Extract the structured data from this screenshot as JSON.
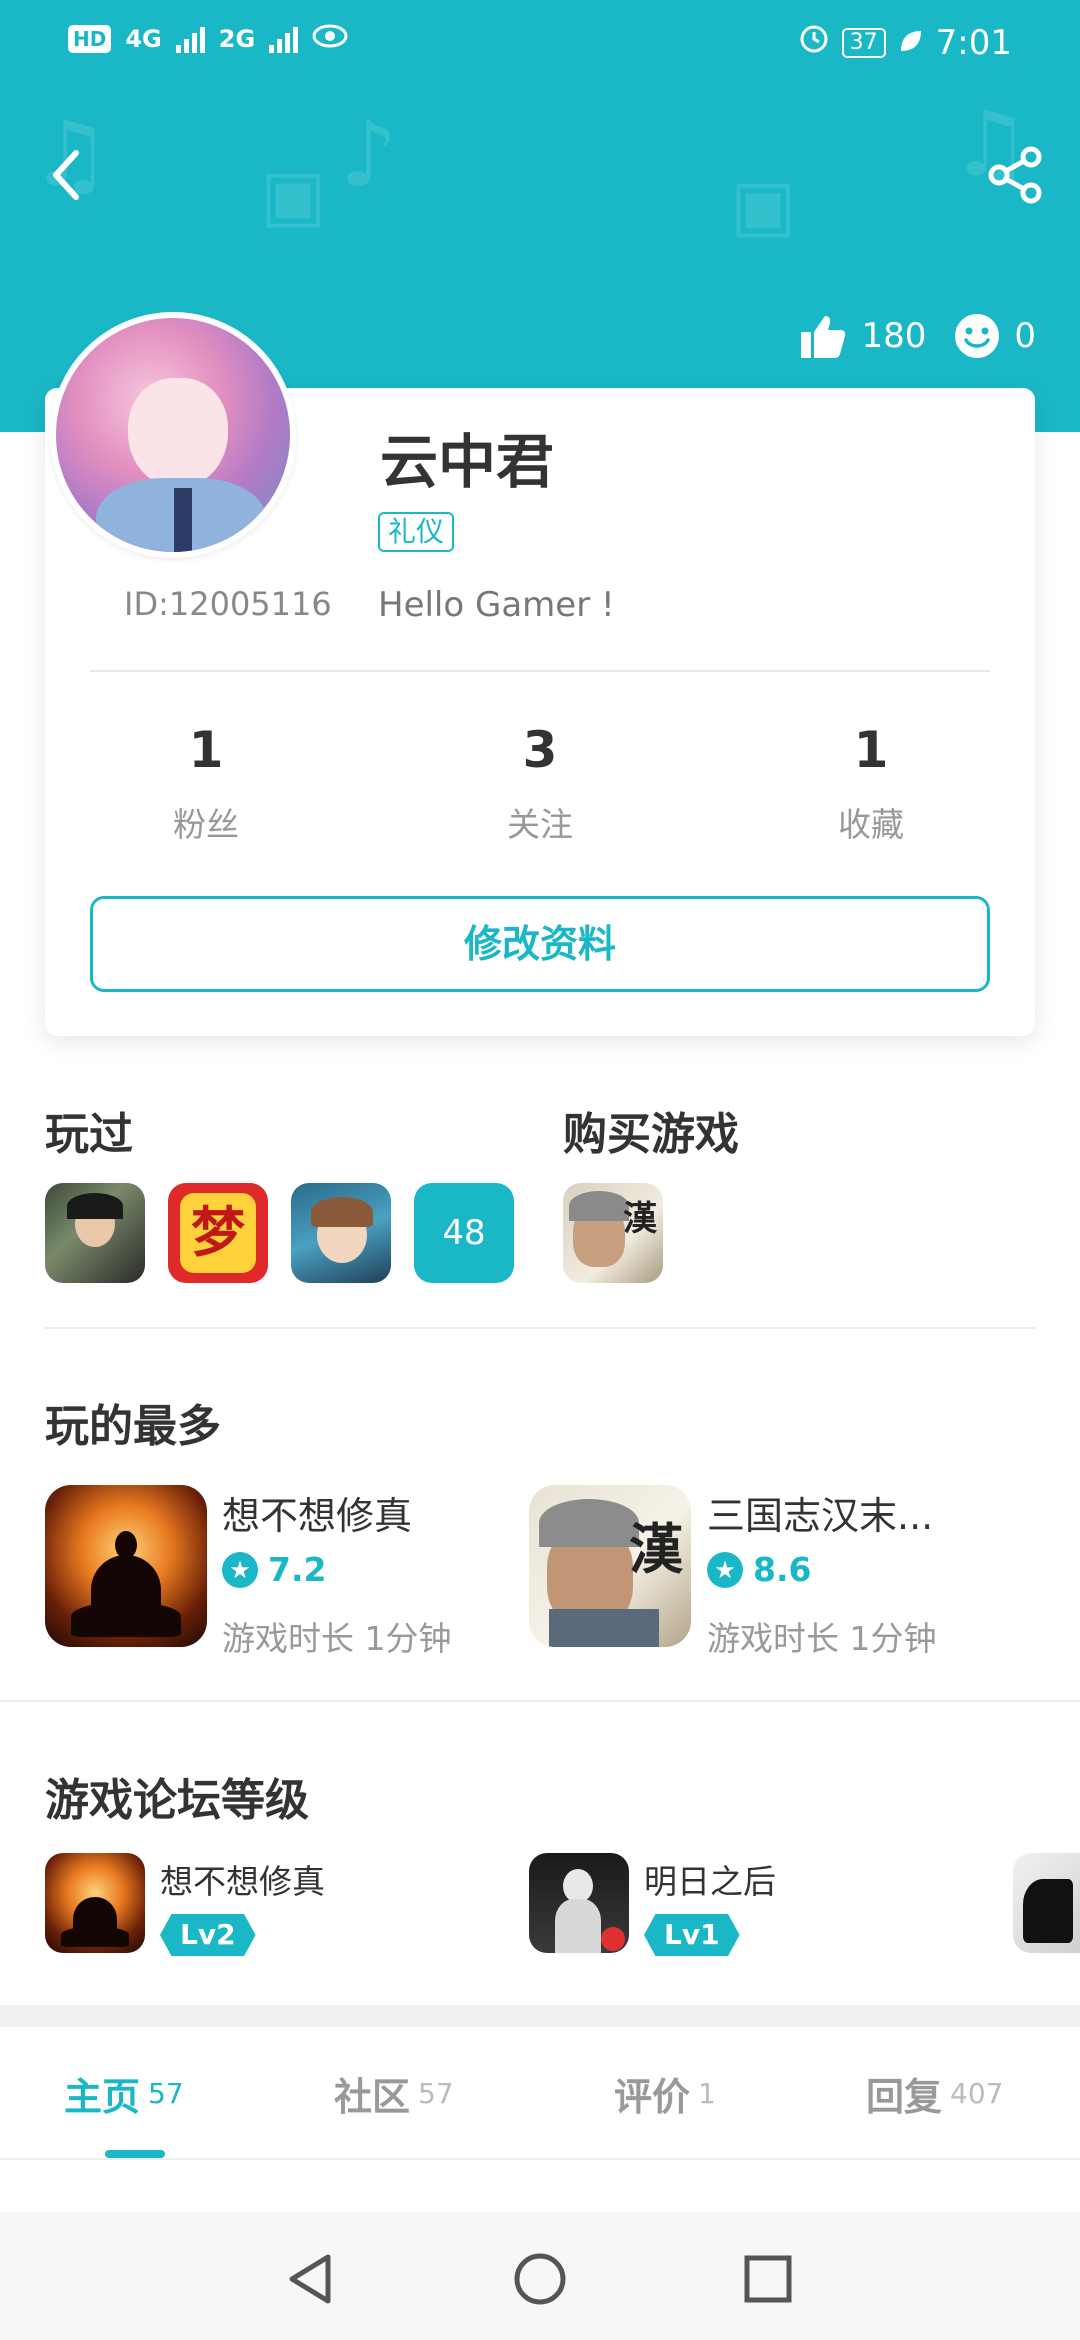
{
  "status_bar": {
    "hd": "HD",
    "net1": "4G",
    "net2": "2G",
    "battery": "37",
    "time": "7:01"
  },
  "header": {
    "likes": "180",
    "smiles": "0"
  },
  "profile": {
    "username": "云中君",
    "tag": "礼仪",
    "id": "ID:12005116",
    "bio": "Hello Gamer !",
    "stats": [
      {
        "num": "1",
        "label": "粉丝"
      },
      {
        "num": "3",
        "label": "关注"
      },
      {
        "num": "1",
        "label": "收藏"
      }
    ],
    "edit_label": "修改资料"
  },
  "played": {
    "title": "玩过",
    "more_count": "48"
  },
  "purchased": {
    "title": "购买游戏",
    "badge_char": "漢"
  },
  "most_played": {
    "title": "玩的最多",
    "games": [
      {
        "name": "想不想修真",
        "rating": "7.2",
        "time": "游戏时长 1分钟"
      },
      {
        "name": "三国志汉末...",
        "rating": "8.6",
        "time": "游戏时长 1分钟",
        "icon_char": "漢"
      }
    ]
  },
  "forum_level": {
    "title": "游戏论坛等级",
    "items": [
      {
        "name": "想不想修真",
        "level": "Lv2"
      },
      {
        "name": "明日之后",
        "level": "Lv1"
      }
    ]
  },
  "tabs": [
    {
      "label": "主页",
      "count": "57"
    },
    {
      "label": "社区",
      "count": "57"
    },
    {
      "label": "评价",
      "count": "1"
    },
    {
      "label": "回复",
      "count": "407"
    }
  ],
  "colors": {
    "accent": "#1ab8c6"
  },
  "icons": {
    "back": "chevron-left-icon",
    "share": "share-icon",
    "like": "thumbs-up-icon",
    "smile": "smile-icon"
  }
}
